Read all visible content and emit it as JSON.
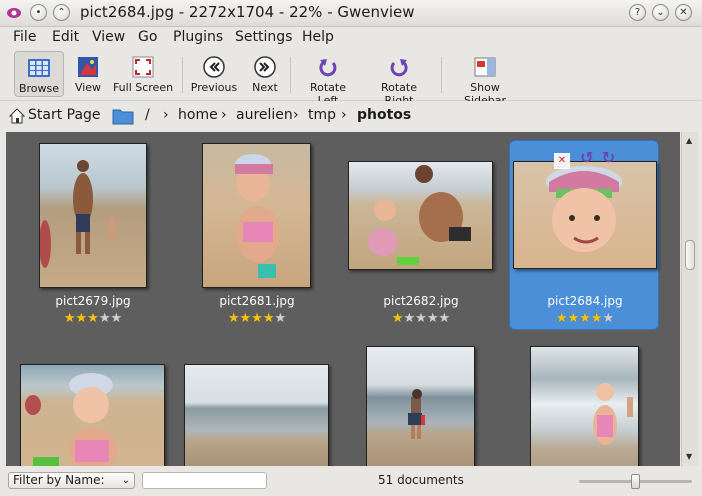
{
  "window": {
    "title": "pict2684.jpg - 2272x1704 - 22% - Gwenview"
  },
  "menu": [
    "File",
    "Edit",
    "View",
    "Go",
    "Plugins",
    "Settings",
    "Help"
  ],
  "toolbar": {
    "browse": "Browse",
    "view": "View",
    "fullscreen": "Full Screen",
    "previous": "Previous",
    "next": "Next",
    "rotate_left": "Rotate Left",
    "rotate_right": "Rotate Right",
    "show_sidebar": "Show Sidebar"
  },
  "breadcrumb": {
    "start_page": "Start Page",
    "root": "/",
    "parts": [
      "home",
      "aurelien",
      "tmp",
      "photos"
    ]
  },
  "thumbnails": [
    {
      "name": "pict2679.jpg",
      "rating": 3
    },
    {
      "name": "pict2681.jpg",
      "rating": 4
    },
    {
      "name": "pict2682.jpg",
      "rating": 1
    },
    {
      "name": "pict2684.jpg",
      "rating": 4,
      "selected": true
    }
  ],
  "status": {
    "filter_label": "Filter by Name:",
    "filter_value": "",
    "doc_count": "51 documents",
    "zoom_level": 0.5
  },
  "colors": {
    "selection": "#4a8fd8",
    "view_bg": "#5e5e5e",
    "star": "#f2c21a"
  }
}
